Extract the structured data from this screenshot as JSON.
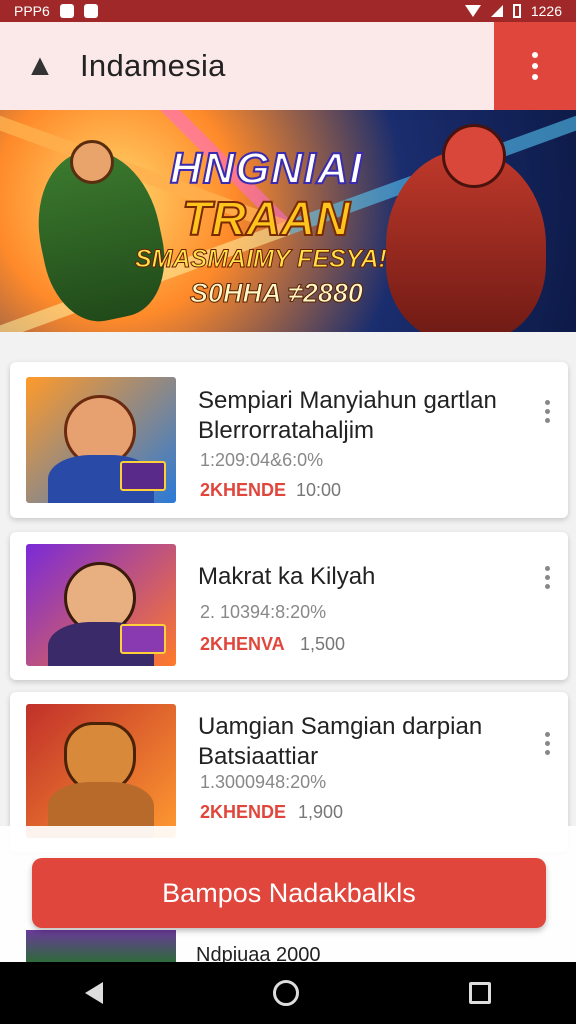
{
  "status_bar": {
    "left_text": "PPP6",
    "time": "1226"
  },
  "app_bar": {
    "back_icon": "back-arrow-icon",
    "title": "Indamesia",
    "menu_icon": "more-vert-icon"
  },
  "banner": {
    "title_line1": "HNGNIAI",
    "title_line2": "TRAAN",
    "subtitle": "SMASMAIMY FESYA!",
    "prize": "S0HHA ≠2880"
  },
  "cards": [
    {
      "title": "Sempiari Manyiahun gartlan Blerrorratahaljim",
      "meta": "1:209:04&6:0%",
      "tag": "2KHENDE",
      "tag_value": "10:00"
    },
    {
      "title": "Makrat ka Kilyah",
      "meta": "2. 10394:8:20%",
      "tag": "2KHENVA",
      "tag_value": "1,500"
    },
    {
      "title": "Uamgian Samgian darpian Batsiaattiar",
      "meta": "1.3000948:20%",
      "tag": "2KHENDE",
      "tag_value": "1,900"
    }
  ],
  "peek_card": {
    "title": "Ndpiuaa 2000"
  },
  "cta": {
    "label": "Bampos Nadakbalkls"
  },
  "colors": {
    "accent": "#e0463c",
    "status_bar": "#a12828",
    "app_bar_bg": "#fbe8e8"
  }
}
